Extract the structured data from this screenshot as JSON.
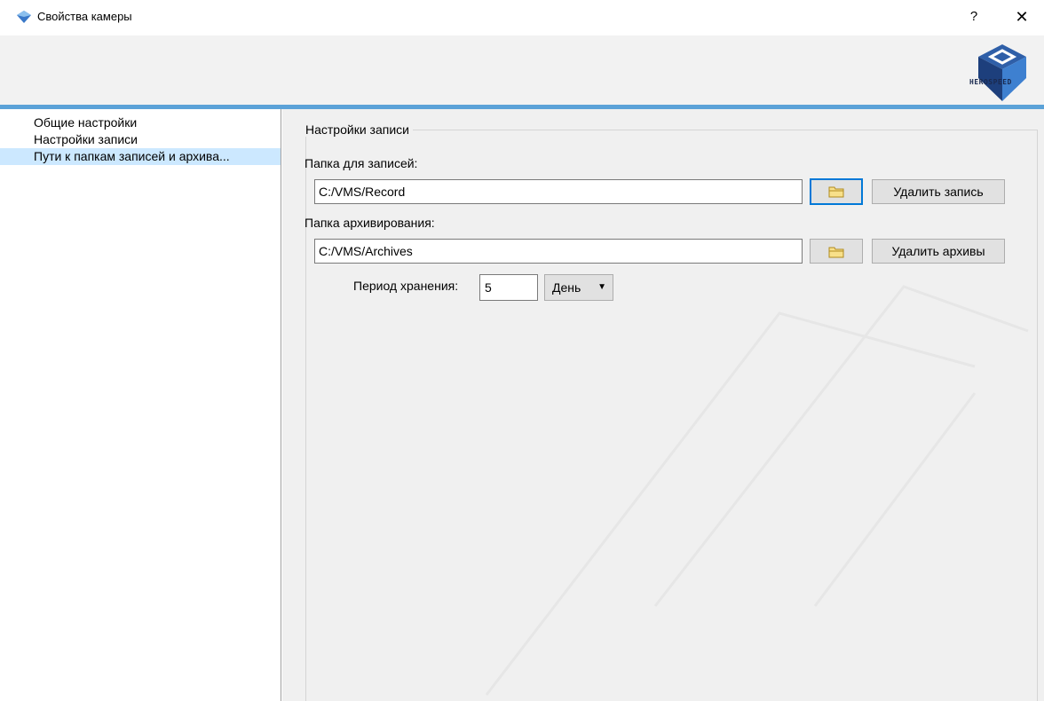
{
  "window": {
    "title": "Свойства камеры",
    "help_label": "?",
    "close_label": "✕"
  },
  "banner": {
    "logo_text": "HEROSPEED"
  },
  "sidebar": {
    "items": [
      {
        "label": "Общие настройки"
      },
      {
        "label": "Настройки записи"
      },
      {
        "label": "Пути к папкам записей и архива..."
      }
    ],
    "selected_index": 2
  },
  "record_settings": {
    "group_title": "Настройки записи",
    "record_folder_label": "Папка для записей:",
    "record_folder_value": "C:/VMS/Record",
    "delete_record_label": "Удалить запись",
    "archive_folder_label": "Папка архивирования:",
    "archive_folder_value": "C:/VMS/Archives",
    "delete_archives_label": "Удалить архивы",
    "retention_label": "Период хранения:",
    "retention_value": "5",
    "retention_unit": "День",
    "retention_unit_arrow": "▼"
  },
  "colors": {
    "accent": "#5ba2d8",
    "selection": "#cce8ff",
    "panel_bg": "#f0f0f0",
    "focus": "#0078d7"
  }
}
